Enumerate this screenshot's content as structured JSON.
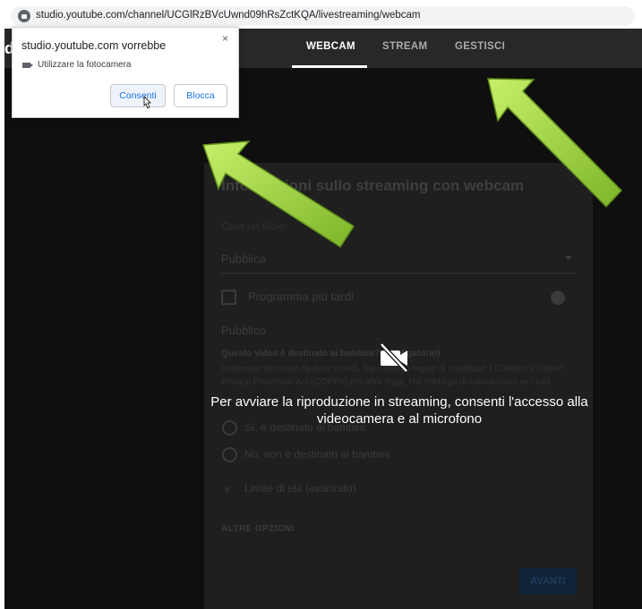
{
  "browser": {
    "url": "studio.youtube.com/channel/UCGlRzBVcUwnd09hRsZctKQA/livestreaming/webcam"
  },
  "header": {
    "left_stub": "d",
    "tabs": [
      {
        "label": "WEBCAM"
      },
      {
        "label": "STREAM"
      },
      {
        "label": "GESTISCI"
      }
    ]
  },
  "modal": {
    "title": "Informazioni sullo streaming con webcam",
    "field_label": "Crea un titolo",
    "visibility": "Pubblica",
    "schedule": "Programma più tardi",
    "audience_heading": "Pubblico",
    "kids_question": "Questo video è destinato ai bambini? (obbligatorio)",
    "kids_text_1": "Indipendentemente da dove risiedi, hai l'obbligo legale di rispettare il Children's Online",
    "kids_text_2": "Privacy Protection Act (COPPA) e/o altre leggi. Hai l'obbligo di comunicarci se i tuoi",
    "option_yes": "Sì, è destinato ai bambini",
    "option_no": "No, non è destinato ai bambini",
    "age_limit": "Limite di età (avanzato)",
    "more_options": "ALTRE OPZIONI",
    "next": "AVANTI"
  },
  "overlay": {
    "message": "Per avviare la riproduzione in streaming, consenti l'accesso alla videocamera e al microfono"
  },
  "permission_popup": {
    "title": "studio.youtube.com vorrebbe",
    "close": "×",
    "request": "Utilizzare la fotocamera",
    "allow": "Consenti",
    "block": "Blocca"
  },
  "colors": {
    "arrow_fill": "#9bd23c",
    "arrow_outline": "#6a9a1f",
    "app_bg": "#0f0f0f",
    "topbar_bg": "#282828"
  }
}
